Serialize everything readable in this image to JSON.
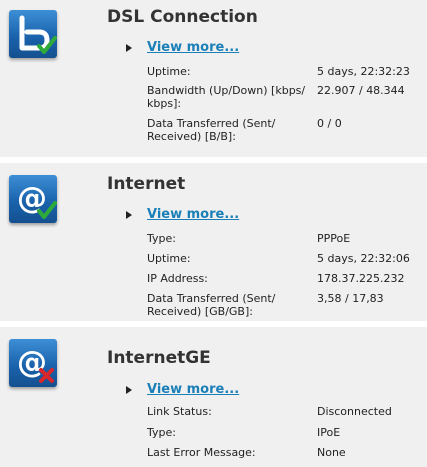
{
  "sections": [
    {
      "title": "DSL Connection",
      "icon": "dsl-b-icon",
      "status": "ok",
      "view_more": "View more...",
      "rows": [
        {
          "label": "Uptime:",
          "value": "5 days, 22:32:23"
        },
        {
          "label": "Bandwidth (Up/Down) [kbps/ kbps]:",
          "value": "22.907 / 48.344"
        },
        {
          "label": "Data Transferred (Sent/ Received) [B/B]:",
          "value": "0 / 0"
        }
      ]
    },
    {
      "title": "Internet",
      "icon": "internet-at-icon",
      "status": "ok",
      "view_more": "View more...",
      "rows": [
        {
          "label": "Type:",
          "value": "PPPoE"
        },
        {
          "label": "Uptime:",
          "value": "5 days, 22:32:06"
        },
        {
          "label": "IP Address:",
          "value": "178.37.225.232"
        },
        {
          "label": "Data Transferred (Sent/ Received) [GB/GB]:",
          "value": "3,58 / 17,83"
        }
      ]
    },
    {
      "title": "InternetGE",
      "icon": "internet-at-icon",
      "status": "error",
      "view_more": "View more...",
      "rows": [
        {
          "label": "Link Status:",
          "value": "Disconnected"
        },
        {
          "label": "Type:",
          "value": "IPoE"
        },
        {
          "label": "Last Error Message:",
          "value": "None"
        }
      ]
    }
  ],
  "colors": {
    "link": "#1b7fb8",
    "icon_blue": "#1a63ad",
    "ok_check": "#2eaa3a",
    "error_x": "#d9262b"
  }
}
